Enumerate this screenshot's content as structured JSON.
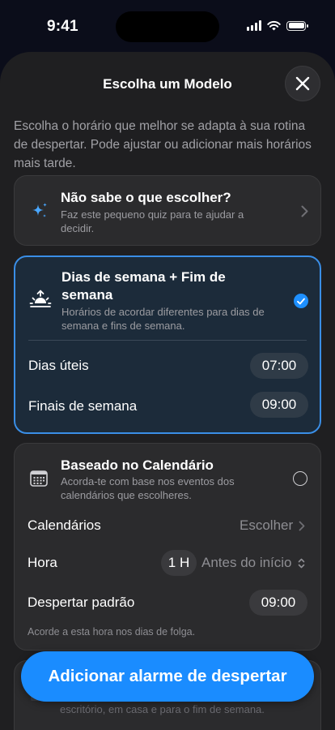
{
  "status_bar": {
    "time": "9:41"
  },
  "sheet": {
    "title": "Escolha um Modelo",
    "intro": "Escolha o horário que melhor se adapta à sua rotina de despertar. Pode ajustar ou adicionar mais horários mais tarde."
  },
  "quiz_card": {
    "title": "Não sabe o que escolher?",
    "subtitle": "Faz este pequeno quiz para te ajudar a decidir."
  },
  "weekday_card": {
    "title": "Dias de semana + Fim de semana",
    "subtitle": "Horários de acordar diferentes para dias de semana e fins de semana.",
    "rows": [
      {
        "label": "Dias úteis",
        "time": "07:00"
      },
      {
        "label": "Finais de semana",
        "time": "09:00"
      }
    ]
  },
  "calendar_card": {
    "title": "Baseado no Calendário",
    "subtitle": "Acorda-te com base nos eventos dos calendários que escolheres.",
    "calendars_label": "Calendários",
    "calendars_value": "Escolher",
    "hora_label": "Hora",
    "hora_value": "1 H",
    "hora_option": "Antes do início",
    "default_label": "Despertar padrão",
    "default_time": "09:00",
    "footnote": "Acorde a esta hora nos dias de folga."
  },
  "partial_card_text": "escritório, em casa e para o fim de semana.",
  "cta_label": "Adicionar alarme de despertar",
  "colors": {
    "accent": "#1a8cff",
    "selected_border": "#3a8ee6",
    "sheet_bg": "#1f1f21"
  }
}
